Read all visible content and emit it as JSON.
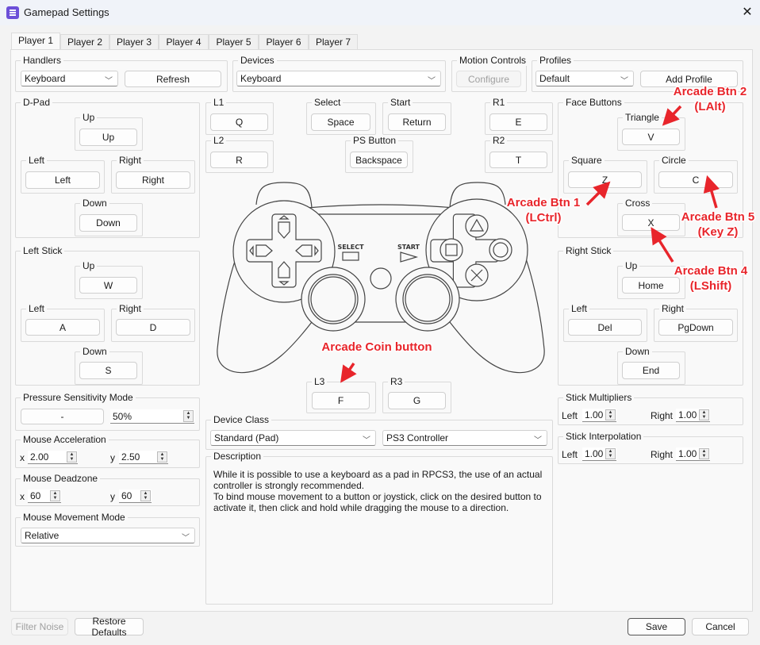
{
  "window": {
    "title": "Gamepad Settings",
    "close_icon": "close-icon"
  },
  "tabs": [
    "Player 1",
    "Player 2",
    "Player 3",
    "Player 4",
    "Player 5",
    "Player 6",
    "Player 7"
  ],
  "handlers": {
    "title": "Handlers",
    "value": "Keyboard",
    "refresh": "Refresh"
  },
  "devices": {
    "title": "Devices",
    "value": "Keyboard"
  },
  "motion": {
    "title": "Motion Controls",
    "configure": "Configure"
  },
  "profiles": {
    "title": "Profiles",
    "value": "Default",
    "add": "Add Profile"
  },
  "dpad": {
    "title": "D-Pad",
    "up_label": "Up",
    "up": "Up",
    "left_label": "Left",
    "left": "Left",
    "right_label": "Right",
    "right": "Right",
    "down_label": "Down",
    "down": "Down"
  },
  "left_stick": {
    "title": "Left Stick",
    "up_label": "Up",
    "up": "W",
    "left_label": "Left",
    "left": "A",
    "right_label": "Right",
    "right": "D",
    "down_label": "Down",
    "down": "S"
  },
  "pressure": {
    "title": "Pressure Sensitivity Mode",
    "button": "-",
    "value": "50%"
  },
  "mouse_accel": {
    "title": "Mouse Acceleration",
    "x_label": "x",
    "x": "2.00",
    "y_label": "y",
    "y": "2.50"
  },
  "mouse_deadzone": {
    "title": "Mouse Deadzone",
    "x_label": "x",
    "x": "60",
    "y_label": "y",
    "y": "60"
  },
  "mouse_mode": {
    "title": "Mouse Movement Mode",
    "value": "Relative"
  },
  "shoulder": {
    "l1_label": "L1",
    "l1": "Q",
    "l2_label": "L2",
    "l2": "R",
    "r1_label": "R1",
    "r1": "E",
    "r2_label": "R2",
    "r2": "T"
  },
  "center": {
    "select_label": "Select",
    "select": "Space",
    "start_label": "Start",
    "start": "Return",
    "ps_label": "PS Button",
    "ps": "Backspace"
  },
  "sticks_press": {
    "l3_label": "L3",
    "l3": "F",
    "r3_label": "R3",
    "r3": "G"
  },
  "controller_image": {
    "select_text": "SELECT",
    "start_text": "START"
  },
  "device_class": {
    "title": "Device Class",
    "class": "Standard (Pad)",
    "type": "PS3 Controller"
  },
  "description": {
    "title": "Description",
    "text1": "While it is possible to use a keyboard as a pad in RPCS3, the use of an actual controller is strongly recommended.",
    "text2": "To bind mouse movement to a button or joystick, click on the desired button to activate it, then click and hold while dragging the mouse to a direction."
  },
  "face": {
    "title": "Face Buttons",
    "triangle_label": "Triangle",
    "triangle": "V",
    "square_label": "Square",
    "square": "Z",
    "circle_label": "Circle",
    "circle": "C",
    "cross_label": "Cross",
    "cross": "X"
  },
  "right_stick": {
    "title": "Right Stick",
    "up_label": "Up",
    "up": "Home",
    "left_label": "Left",
    "left": "Del",
    "right_label": "Right",
    "right": "PgDown",
    "down_label": "Down",
    "down": "End"
  },
  "stick_mult": {
    "title": "Stick Multipliers",
    "left_label": "Left",
    "left": "1.00",
    "right_label": "Right",
    "right": "1.00"
  },
  "stick_interp": {
    "title": "Stick Interpolation",
    "left_label": "Left",
    "left": "1.00",
    "right_label": "Right",
    "right": "1.00"
  },
  "footer": {
    "filter_noise": "Filter Noise",
    "restore": "Restore Defaults",
    "save": "Save",
    "cancel": "Cancel"
  },
  "annotations": {
    "color": "#e8252b",
    "btn2": "Arcade Btn 2",
    "btn2_key": "(LAlt)",
    "btn1": "Arcade Btn 1",
    "btn1_key": "(LCtrl)",
    "btn5": "Arcade Btn 5",
    "btn5_key": "(Key Z)",
    "btn4": "Arcade Btn 4",
    "btn4_key": "(LShift)",
    "coin": "Arcade Coin button"
  }
}
